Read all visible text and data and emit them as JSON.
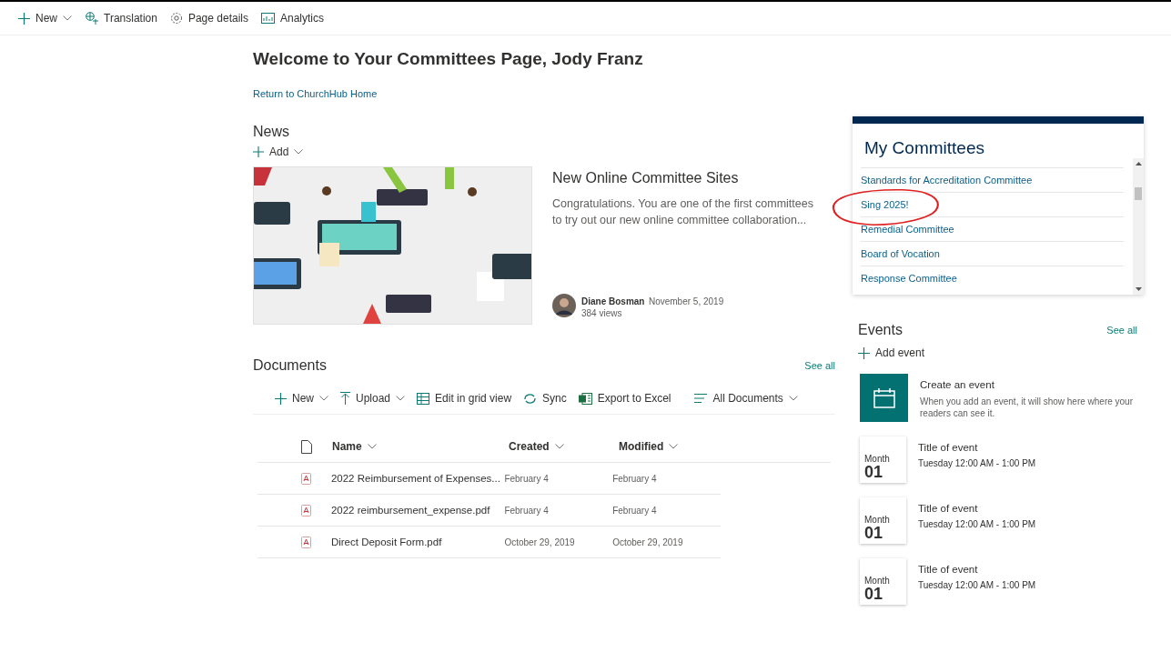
{
  "command_bar": [
    {
      "kind": "new",
      "label": "New",
      "dropdown": true
    },
    {
      "kind": "translation",
      "label": "Translation",
      "dropdown": false
    },
    {
      "kind": "details",
      "label": "Page details",
      "dropdown": false
    },
    {
      "kind": "analytics",
      "label": "Analytics",
      "dropdown": false
    }
  ],
  "page_title": "Welcome to Your Committees Page, Jody Franz",
  "home_link": "Return to ChurchHub Home",
  "news": {
    "title": "News",
    "add_label": "Add",
    "item": {
      "kind": "picture",
      "headline": "New Online Committee Sites",
      "summary": "Congratulations. You are one of the first committees to try out our new online committee collaboration...",
      "author": "Diane Bosman",
      "date": "November 5, 2019",
      "views": "384 views"
    }
  },
  "documents": {
    "title": "Documents",
    "see_all": "See all",
    "toolbar": [
      {
        "kind": "new",
        "label": "New",
        "dropdown": true
      },
      {
        "kind": "upload",
        "label": "Upload",
        "dropdown": true
      },
      {
        "kind": "grid",
        "label": "Edit in grid view",
        "dropdown": false
      },
      {
        "kind": "sync",
        "label": "Sync",
        "dropdown": false
      },
      {
        "kind": "excel",
        "label": "Export to Excel",
        "dropdown": false
      }
    ],
    "view": "All Documents",
    "columns": [
      "Name",
      "Created",
      "Modified"
    ],
    "rows": [
      {
        "name": "2022 Reimbursement of Expenses...",
        "created": "February 4",
        "modified": "February 4"
      },
      {
        "name": "2022 reimbursement_expense.pdf",
        "created": "February 4",
        "modified": "February 4"
      },
      {
        "name": "Direct Deposit Form.pdf",
        "created": "October 29, 2019",
        "modified": "October 29, 2019"
      }
    ]
  },
  "my_committees": {
    "title": "My Committees",
    "items": [
      "Standards for Accreditation Committee",
      "Sing 2025!",
      "Remedial Committee",
      "Board of Vocation",
      "Response Committee"
    ]
  },
  "events": {
    "title": "Events",
    "see_all": "See all",
    "add_label": "Add event",
    "create": {
      "title": "Create an event",
      "text": "When you add an event, it will show here where your readers can see it."
    },
    "items": [
      {
        "month": "Month",
        "day": "01",
        "title": "Title of event",
        "time": "Tuesday 12:00 AM - 1:00 PM"
      },
      {
        "month": "Month",
        "day": "01",
        "title": "Title of event",
        "time": "Tuesday 12:00 AM - 1:00 PM"
      },
      {
        "month": "Month",
        "day": "01",
        "title": "Title of event",
        "time": "Tuesday 12:00 AM - 1:00 PM"
      }
    ]
  }
}
